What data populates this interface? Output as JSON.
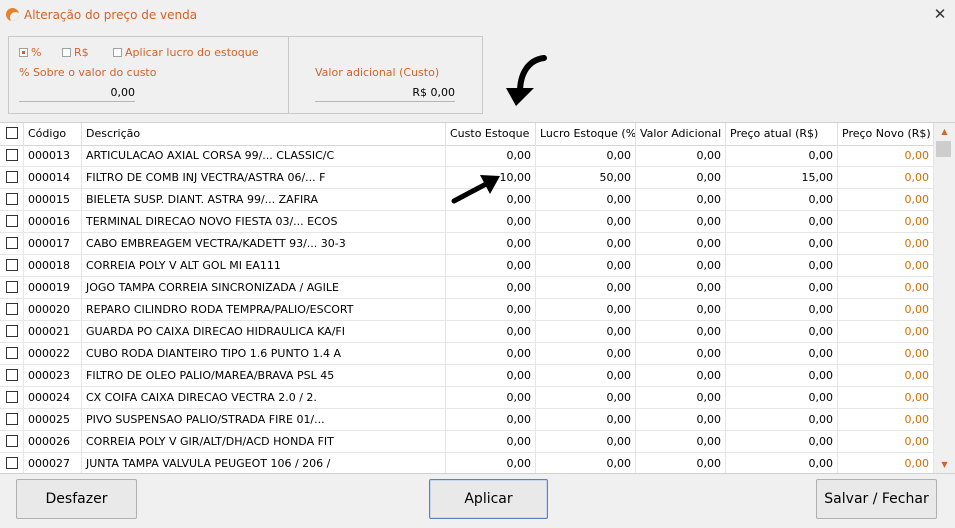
{
  "window": {
    "title": "Alteração do preço de venda",
    "close_label": "✕"
  },
  "options": {
    "percent_label": "%",
    "real_label": "R$",
    "lucro_estoque_label": "Aplicar lucro do estoque",
    "selected": "%"
  },
  "fields": {
    "sobre_custo_label": "% Sobre o valor do custo",
    "sobre_custo_value": "0,00",
    "valor_adicional_label": "Valor adicional (Custo)",
    "valor_adicional_value": "R$ 0,00"
  },
  "table": {
    "columns": [
      "Código",
      "Descrição",
      "Custo Estoque",
      "Lucro Estoque (%)",
      "Valor Adicional",
      "Preço atual (R$)",
      "Preço Novo (R$)"
    ],
    "rows": [
      {
        "codigo": "000013",
        "descricao": "ARTICULACAO AXIAL CORSA 99/... CLASSIC/C",
        "custo": "0,00",
        "lucro": "0,00",
        "adicional": "0,00",
        "atual": "0,00",
        "novo": "0,00"
      },
      {
        "codigo": "000014",
        "descricao": "FILTRO DE COMB INJ VECTRA/ASTRA 06/... F",
        "custo": "10,00",
        "lucro": "50,00",
        "adicional": "0,00",
        "atual": "15,00",
        "novo": "0,00"
      },
      {
        "codigo": "000015",
        "descricao": "BIELETA SUSP. DIANT. ASTRA 99/... ZAFIRA",
        "custo": "0,00",
        "lucro": "0,00",
        "adicional": "0,00",
        "atual": "0,00",
        "novo": "0,00"
      },
      {
        "codigo": "000016",
        "descricao": "TERMINAL DIRECAO NOVO FIESTA 03/... ECOS",
        "custo": "0,00",
        "lucro": "0,00",
        "adicional": "0,00",
        "atual": "0,00",
        "novo": "0,00"
      },
      {
        "codigo": "000017",
        "descricao": "CABO EMBREAGEM VECTRA/KADETT 93/... 30-3",
        "custo": "0,00",
        "lucro": "0,00",
        "adicional": "0,00",
        "atual": "0,00",
        "novo": "0,00"
      },
      {
        "codigo": "000018",
        "descricao": "CORREIA POLY V ALT GOL MI EA111",
        "custo": "0,00",
        "lucro": "0,00",
        "adicional": "0,00",
        "atual": "0,00",
        "novo": "0,00"
      },
      {
        "codigo": "000019",
        "descricao": "JOGO TAMPA CORREIA SINCRONIZADA / AGILE",
        "custo": "0,00",
        "lucro": "0,00",
        "adicional": "0,00",
        "atual": "0,00",
        "novo": "0,00"
      },
      {
        "codigo": "000020",
        "descricao": "REPARO CILINDRO RODA TEMPRA/PALIO/ESCORT",
        "custo": "0,00",
        "lucro": "0,00",
        "adicional": "0,00",
        "atual": "0,00",
        "novo": "0,00"
      },
      {
        "codigo": "000021",
        "descricao": "GUARDA PO CAIXA DIRECAO HIDRAULICA KA/FI",
        "custo": "0,00",
        "lucro": "0,00",
        "adicional": "0,00",
        "atual": "0,00",
        "novo": "0,00"
      },
      {
        "codigo": "000022",
        "descricao": "CUBO RODA DIANTEIRO TIPO 1.6 PUNTO 1.4 A",
        "custo": "0,00",
        "lucro": "0,00",
        "adicional": "0,00",
        "atual": "0,00",
        "novo": "0,00"
      },
      {
        "codigo": "000023",
        "descricao": "FILTRO DE OLEO PALIO/MAREA/BRAVA PSL 45",
        "custo": "0,00",
        "lucro": "0,00",
        "adicional": "0,00",
        "atual": "0,00",
        "novo": "0,00"
      },
      {
        "codigo": "000024",
        "descricao": "CX COIFA CAIXA DIRECAO VECTRA 2.0 / 2.",
        "custo": "0,00",
        "lucro": "0,00",
        "adicional": "0,00",
        "atual": "0,00",
        "novo": "0,00"
      },
      {
        "codigo": "000025",
        "descricao": "PIVO SUSPENSAO PALIO/STRADA FIRE 01/...",
        "custo": "0,00",
        "lucro": "0,00",
        "adicional": "0,00",
        "atual": "0,00",
        "novo": "0,00"
      },
      {
        "codigo": "000026",
        "descricao": "CORREIA POLY V GIR/ALT/DH/ACD HONDA FIT",
        "custo": "0,00",
        "lucro": "0,00",
        "adicional": "0,00",
        "atual": "0,00",
        "novo": "0,00"
      },
      {
        "codigo": "000027",
        "descricao": "JUNTA TAMPA VALVULA PEUGEOT 106 / 206 /",
        "custo": "0,00",
        "lucro": "0,00",
        "adicional": "0,00",
        "atual": "0,00",
        "novo": "0,00"
      }
    ]
  },
  "buttons": {
    "desfazer": "Desfazer",
    "aplicar": "Aplicar",
    "salvar_fechar": "Salvar / Fechar"
  },
  "colors": {
    "accent": "#d0642a",
    "price_new": "#d07000"
  }
}
